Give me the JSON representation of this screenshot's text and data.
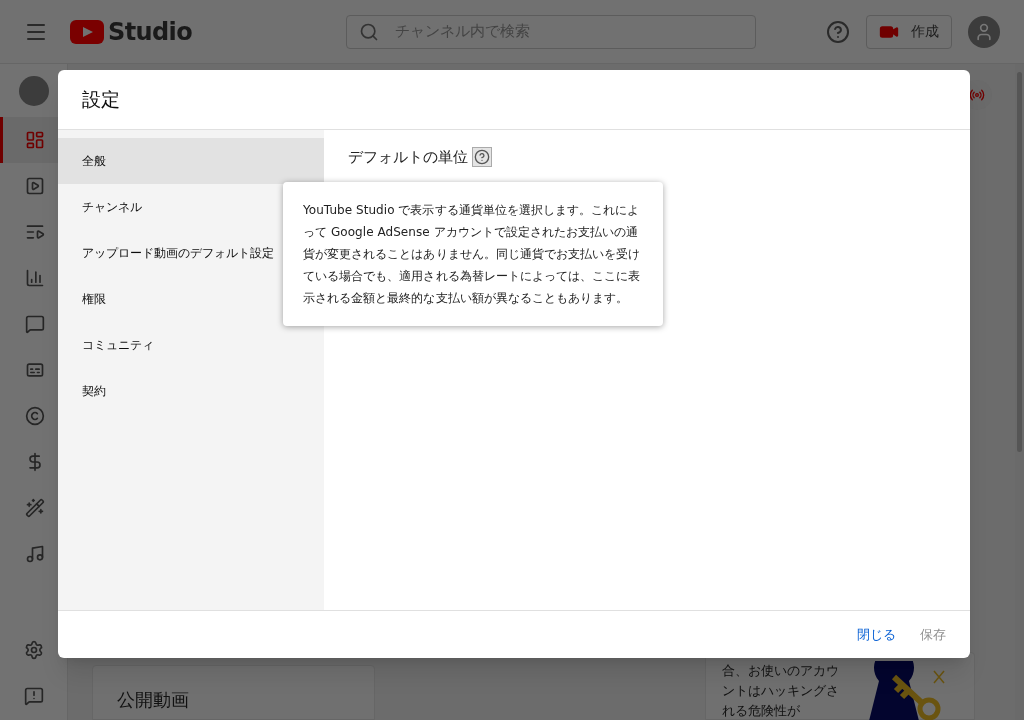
{
  "header": {
    "logo": "Studio",
    "search": {
      "placeholder": "チャンネル内で検索"
    },
    "create_button": "作成"
  },
  "rail_items": [
    {
      "selected": true
    },
    {
      "selected": false
    },
    {
      "selected": false
    },
    {
      "selected": false
    },
    {
      "selected": false
    },
    {
      "selected": false
    },
    {
      "selected": false
    },
    {
      "selected": false
    },
    {
      "selected": false
    },
    {
      "selected": false
    }
  ],
  "background": {
    "card_title": "公開動画",
    "side_text": "合、お使いのアカウントはハッキングされる危険性が"
  },
  "dialog": {
    "title": "設定",
    "nav": [
      {
        "label": "全般",
        "selected": true
      },
      {
        "label": "チャンネル",
        "selected": false
      },
      {
        "label": "アップロード動画のデフォルト設定",
        "selected": false
      },
      {
        "label": "権限",
        "selected": false
      },
      {
        "label": "コミュニティ",
        "selected": false
      },
      {
        "label": "契約",
        "selected": false
      }
    ],
    "section_label": "デフォルトの単位",
    "tooltip": "YouTube Studio で表示する通貨単位を選択します。これによって Google AdSense アカウントで設定されたお支払いの通貨が変更されることはありません。同じ通貨でお支払いを受けている場合でも、適用される為替レートによっては、ここに表示される金額と最終的な支払い額が異なることもあります。",
    "buttons": [
      {
        "label": "閉じる",
        "disabled": false
      },
      {
        "label": "保存",
        "disabled": true
      }
    ]
  }
}
